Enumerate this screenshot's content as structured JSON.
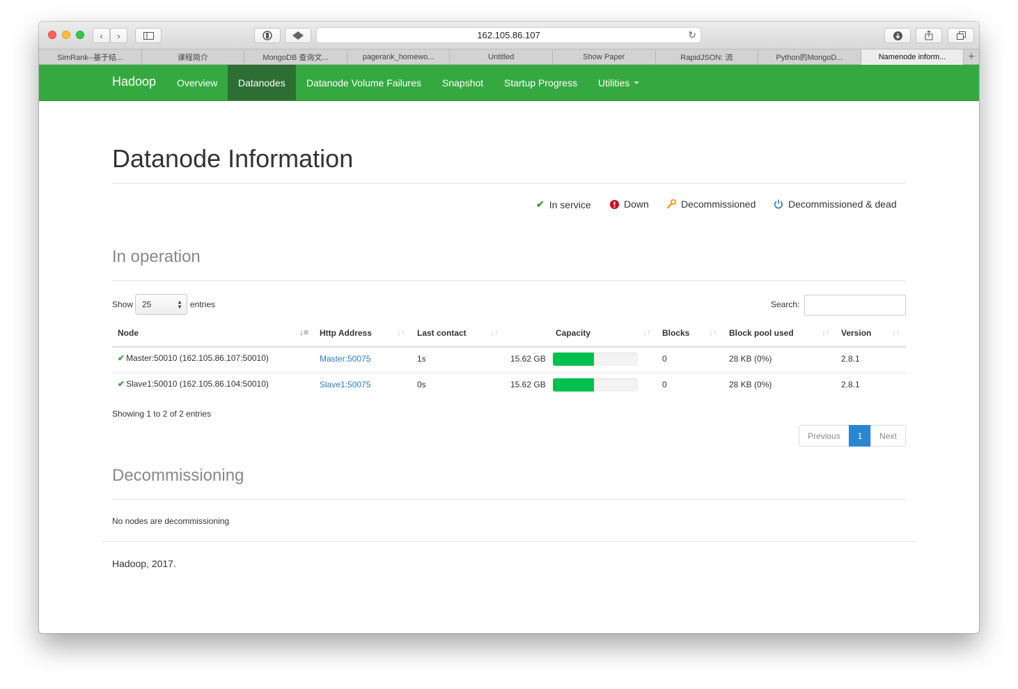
{
  "browser": {
    "url": "162.105.86.107",
    "tabs": [
      "SimRank--基于结...",
      "课程简介",
      "MongoDB 查询文...",
      "pagerank_homewo...",
      "Untitled",
      "Show Paper",
      "RapidJSON: 流",
      "Python的MongoD...",
      "Namenode inform..."
    ],
    "active_tab_index": 8
  },
  "navbar": {
    "brand": "Hadoop",
    "items": [
      "Overview",
      "Datanodes",
      "Datanode Volume Failures",
      "Snapshot",
      "Startup Progress",
      "Utilities"
    ],
    "active": "Datanodes"
  },
  "page": {
    "title": "Datanode Information",
    "legend": [
      {
        "icon": "check-icon",
        "label": "In service",
        "color": "#3c9a3c"
      },
      {
        "icon": "exclamation-circle-icon",
        "label": "Down",
        "color": "#d0021b"
      },
      {
        "icon": "wrench-icon",
        "label": "Decommissioned",
        "color": "#f0a020"
      },
      {
        "icon": "power-icon",
        "label": "Decommissioned & dead",
        "color": "#2a7bc9"
      }
    ]
  },
  "in_operation": {
    "title": "In operation",
    "show_label": "Show",
    "entries_value": "25",
    "entries_label": "entries",
    "search_label": "Search:",
    "search_value": "",
    "columns": [
      "Node",
      "Http Address",
      "Last contact",
      "Capacity",
      "Blocks",
      "Block pool used",
      "Version"
    ],
    "rows": [
      {
        "node": "Master:50010 (162.105.86.107:50010)",
        "http": "Master:50075",
        "last_contact": "1s",
        "capacity": "15.62 GB",
        "capacity_used_fraction": 0.48,
        "blocks": "0",
        "block_pool_used": "28 KB (0%)",
        "version": "2.8.1"
      },
      {
        "node": "Slave1:50010 (162.105.86.104:50010)",
        "http": "Slave1:50075",
        "last_contact": "0s",
        "capacity": "15.62 GB",
        "capacity_used_fraction": 0.48,
        "blocks": "0",
        "block_pool_used": "28 KB (0%)",
        "version": "2.8.1"
      }
    ],
    "info": "Showing 1 to 2 of 2 entries",
    "pagination": {
      "previous": "Previous",
      "current": "1",
      "next": "Next"
    }
  },
  "decommissioning": {
    "title": "Decommissioning",
    "message": "No nodes are decommissioning"
  },
  "footer": {
    "text": "Hadoop, 2017."
  }
}
